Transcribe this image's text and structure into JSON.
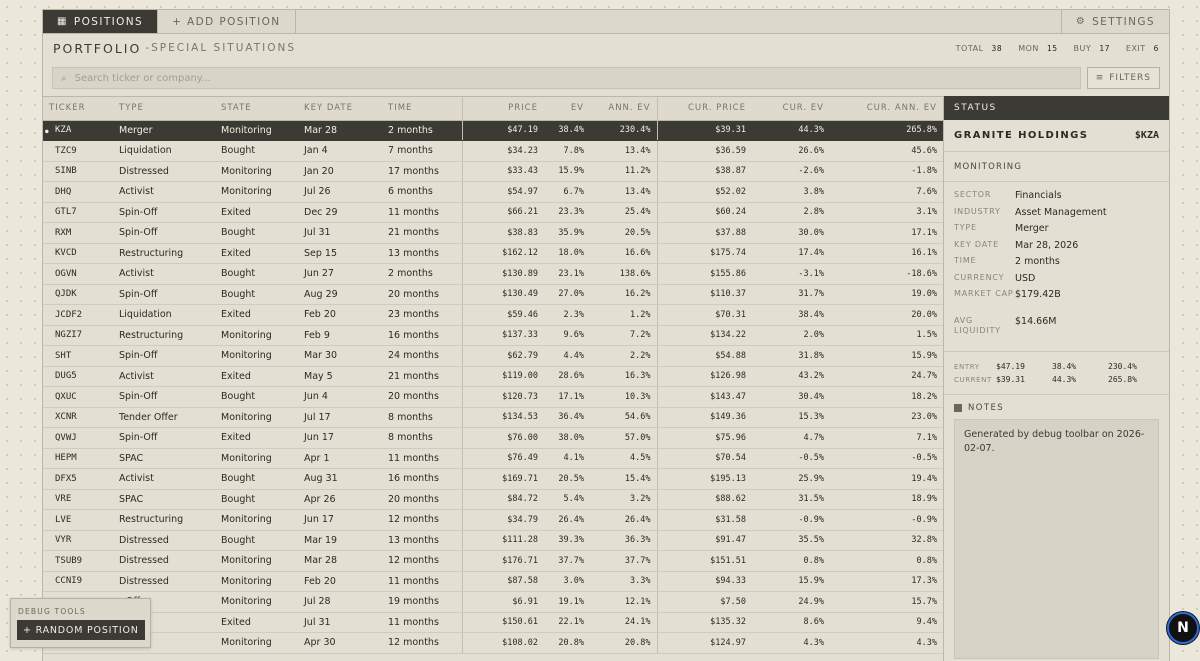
{
  "nav": {
    "positions_label": "POSITIONS",
    "add_label": "+ ADD POSITION",
    "settings_label": "SETTINGS"
  },
  "header": {
    "title": "PORTFOLIO",
    "subtitle": "-SPECIAL SITUATIONS",
    "stats": [
      {
        "label": "TOTAL",
        "value": "38"
      },
      {
        "label": "MON",
        "value": "15"
      },
      {
        "label": "BUY",
        "value": "17"
      },
      {
        "label": "EXIT",
        "value": "6"
      }
    ]
  },
  "search": {
    "placeholder": "Search ticker or company...",
    "filters_label": "FILTERS"
  },
  "table": {
    "columns": [
      "TICKER",
      "TYPE",
      "STATE",
      "KEY DATE",
      "TIME",
      "PRICE",
      "EV",
      "ANN. EV",
      "CUR. PRICE",
      "CUR. EV",
      "CUR. ANN. EV"
    ],
    "rows": [
      [
        "KZA",
        "Merger",
        "Monitoring",
        "Mar 28",
        "2 months",
        "$47.19",
        "38.4%",
        "230.4%",
        "$39.31",
        "44.3%",
        "265.8%"
      ],
      [
        "TZC9",
        "Liquidation",
        "Bought",
        "Jan 4",
        "7 months",
        "$34.23",
        "7.8%",
        "13.4%",
        "$36.59",
        "26.6%",
        "45.6%"
      ],
      [
        "SINB",
        "Distressed",
        "Monitoring",
        "Jan 20",
        "17 months",
        "$33.43",
        "15.9%",
        "11.2%",
        "$38.87",
        "-2.6%",
        "-1.8%"
      ],
      [
        "DHQ",
        "Activist",
        "Monitoring",
        "Jul 26",
        "6 months",
        "$54.97",
        "6.7%",
        "13.4%",
        "$52.02",
        "3.8%",
        "7.6%"
      ],
      [
        "GTL7",
        "Spin-Off",
        "Exited",
        "Dec 29",
        "11 months",
        "$66.21",
        "23.3%",
        "25.4%",
        "$60.24",
        "2.8%",
        "3.1%"
      ],
      [
        "RXM",
        "Spin-Off",
        "Bought",
        "Jul 31",
        "21 months",
        "$38.83",
        "35.9%",
        "20.5%",
        "$37.88",
        "30.0%",
        "17.1%"
      ],
      [
        "KVCD",
        "Restructuring",
        "Exited",
        "Sep 15",
        "13 months",
        "$162.12",
        "18.0%",
        "16.6%",
        "$175.74",
        "17.4%",
        "16.1%"
      ],
      [
        "OGVN",
        "Activist",
        "Bought",
        "Jun 27",
        "2 months",
        "$130.89",
        "23.1%",
        "138.6%",
        "$155.86",
        "-3.1%",
        "-18.6%"
      ],
      [
        "QJDK",
        "Spin-Off",
        "Bought",
        "Aug 29",
        "20 months",
        "$130.49",
        "27.0%",
        "16.2%",
        "$110.37",
        "31.7%",
        "19.0%"
      ],
      [
        "JCDF2",
        "Liquidation",
        "Exited",
        "Feb 20",
        "23 months",
        "$59.46",
        "2.3%",
        "1.2%",
        "$70.31",
        "38.4%",
        "20.0%"
      ],
      [
        "NGZI7",
        "Restructuring",
        "Monitoring",
        "Feb 9",
        "16 months",
        "$137.33",
        "9.6%",
        "7.2%",
        "$134.22",
        "2.0%",
        "1.5%"
      ],
      [
        "SHT",
        "Spin-Off",
        "Monitoring",
        "Mar 30",
        "24 months",
        "$62.79",
        "4.4%",
        "2.2%",
        "$54.88",
        "31.8%",
        "15.9%"
      ],
      [
        "DUG5",
        "Activist",
        "Exited",
        "May 5",
        "21 months",
        "$119.00",
        "28.6%",
        "16.3%",
        "$126.98",
        "43.2%",
        "24.7%"
      ],
      [
        "QXUC",
        "Spin-Off",
        "Bought",
        "Jun 4",
        "20 months",
        "$120.73",
        "17.1%",
        "10.3%",
        "$143.47",
        "30.4%",
        "18.2%"
      ],
      [
        "XCNR",
        "Tender Offer",
        "Monitoring",
        "Jul 17",
        "8 months",
        "$134.53",
        "36.4%",
        "54.6%",
        "$149.36",
        "15.3%",
        "23.0%"
      ],
      [
        "QVWJ",
        "Spin-Off",
        "Exited",
        "Jun 17",
        "8 months",
        "$76.00",
        "38.0%",
        "57.0%",
        "$75.96",
        "4.7%",
        "7.1%"
      ],
      [
        "HEPM",
        "SPAC",
        "Monitoring",
        "Apr 1",
        "11 months",
        "$76.49",
        "4.1%",
        "4.5%",
        "$70.54",
        "-0.5%",
        "-0.5%"
      ],
      [
        "DFX5",
        "Activist",
        "Bought",
        "Aug 31",
        "16 months",
        "$169.71",
        "20.5%",
        "15.4%",
        "$195.13",
        "25.9%",
        "19.4%"
      ],
      [
        "VRE",
        "SPAC",
        "Bought",
        "Apr 26",
        "20 months",
        "$84.72",
        "5.4%",
        "3.2%",
        "$88.62",
        "31.5%",
        "18.9%"
      ],
      [
        "LVE",
        "Restructuring",
        "Monitoring",
        "Jun 17",
        "12 months",
        "$34.79",
        "26.4%",
        "26.4%",
        "$31.58",
        "-0.9%",
        "-0.9%"
      ],
      [
        "VYR",
        "Distressed",
        "Bought",
        "Mar 19",
        "13 months",
        "$111.28",
        "39.3%",
        "36.3%",
        "$91.47",
        "35.5%",
        "32.8%"
      ],
      [
        "TSUB9",
        "Distressed",
        "Monitoring",
        "Mar 28",
        "12 months",
        "$176.71",
        "37.7%",
        "37.7%",
        "$151.51",
        "0.8%",
        "0.8%"
      ],
      [
        "CCNI9",
        "Distressed",
        "Monitoring",
        "Feb 20",
        "11 months",
        "$87.58",
        "3.0%",
        "3.3%",
        "$94.33",
        "15.9%",
        "17.3%"
      ],
      [
        "",
        "r Offer",
        "Monitoring",
        "Jul 28",
        "19 months",
        "$6.91",
        "19.1%",
        "12.1%",
        "$7.50",
        "24.9%",
        "15.7%"
      ],
      [
        "",
        "ssed",
        "Exited",
        "Jul 31",
        "11 months",
        "$150.61",
        "22.1%",
        "24.1%",
        "$135.32",
        "8.6%",
        "9.4%"
      ],
      [
        "",
        "ation",
        "Monitoring",
        "Apr 30",
        "12 months",
        "$108.02",
        "20.8%",
        "20.8%",
        "$124.97",
        "4.3%",
        "4.3%"
      ]
    ]
  },
  "status": {
    "heading": "STATUS",
    "name": "GRANITE HOLDINGS",
    "ticker": "$KZA",
    "state": "MONITORING",
    "details": [
      {
        "k": "SECTOR",
        "v": "Financials"
      },
      {
        "k": "INDUSTRY",
        "v": "Asset Management"
      },
      {
        "k": "TYPE",
        "v": "Merger"
      },
      {
        "k": "KEY DATE",
        "v": "Mar 28, 2026"
      },
      {
        "k": "TIME",
        "v": "2 months"
      },
      {
        "k": "CURRENCY",
        "v": "USD"
      },
      {
        "k": "MARKET CAP",
        "v": "$179.42B"
      },
      {
        "k": "AVG LIQUIDITY",
        "v": "$14.66M"
      }
    ],
    "entry": {
      "label": "ENTRY",
      "price": "$47.19",
      "ev": "38.4%",
      "ann": "230.4%"
    },
    "current": {
      "label": "CURRENT",
      "price": "$39.31",
      "ev": "44.3%",
      "ann": "265.8%"
    },
    "notes_label": "NOTES",
    "notes_text": "Generated by debug toolbar on 2026-02-07."
  },
  "debug": {
    "label": "DEBUG TOOLS",
    "button": "+ RANDOM POSITION"
  },
  "badge": "N"
}
